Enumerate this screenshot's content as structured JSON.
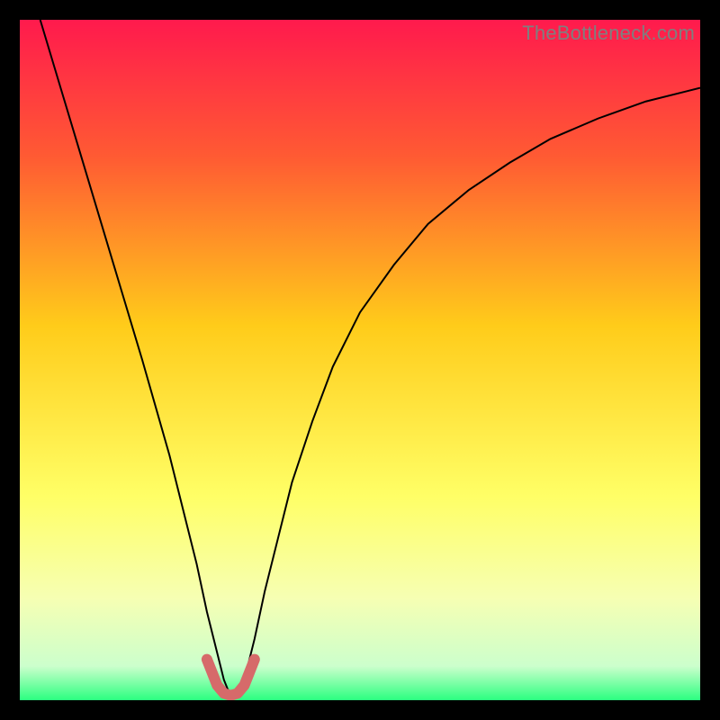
{
  "watermark": "TheBottleneck.com",
  "chart_data": {
    "type": "line",
    "title": "",
    "xlabel": "",
    "ylabel": "",
    "xlim": [
      0,
      100
    ],
    "ylim": [
      0,
      100
    ],
    "grid": false,
    "legend": false,
    "gradient_stops": [
      {
        "offset": 0.0,
        "color": "#ff1a4d"
      },
      {
        "offset": 0.2,
        "color": "#ff5a33"
      },
      {
        "offset": 0.45,
        "color": "#ffcc1a"
      },
      {
        "offset": 0.7,
        "color": "#ffff66"
      },
      {
        "offset": 0.85,
        "color": "#f6ffb3"
      },
      {
        "offset": 0.95,
        "color": "#ccffcc"
      },
      {
        "offset": 1.0,
        "color": "#2bff80"
      }
    ],
    "series": [
      {
        "name": "bottleneck-curve",
        "stroke": "#000000",
        "stroke_width": 2,
        "x": [
          3,
          6,
          9,
          12,
          15,
          18,
          20,
          22,
          24,
          26,
          27.5,
          29,
          30,
          31,
          32,
          33,
          34.5,
          36,
          38,
          40,
          43,
          46,
          50,
          55,
          60,
          66,
          72,
          78,
          85,
          92,
          100
        ],
        "y": [
          100,
          90,
          80,
          70,
          60,
          50,
          43,
          36,
          28,
          20,
          13,
          7,
          3,
          0.5,
          0.5,
          3,
          9,
          16,
          24,
          32,
          41,
          49,
          57,
          64,
          70,
          75,
          79,
          82.5,
          85.5,
          88,
          90
        ]
      },
      {
        "name": "optimal-zone-marker",
        "stroke": "#d66a6a",
        "stroke_width": 12,
        "linecap": "round",
        "x": [
          27.5,
          29,
          30,
          31,
          32,
          33,
          34.5
        ],
        "y": [
          6,
          2.2,
          1.0,
          0.7,
          1.0,
          2.2,
          6
        ]
      }
    ],
    "optimal_x": 31
  }
}
